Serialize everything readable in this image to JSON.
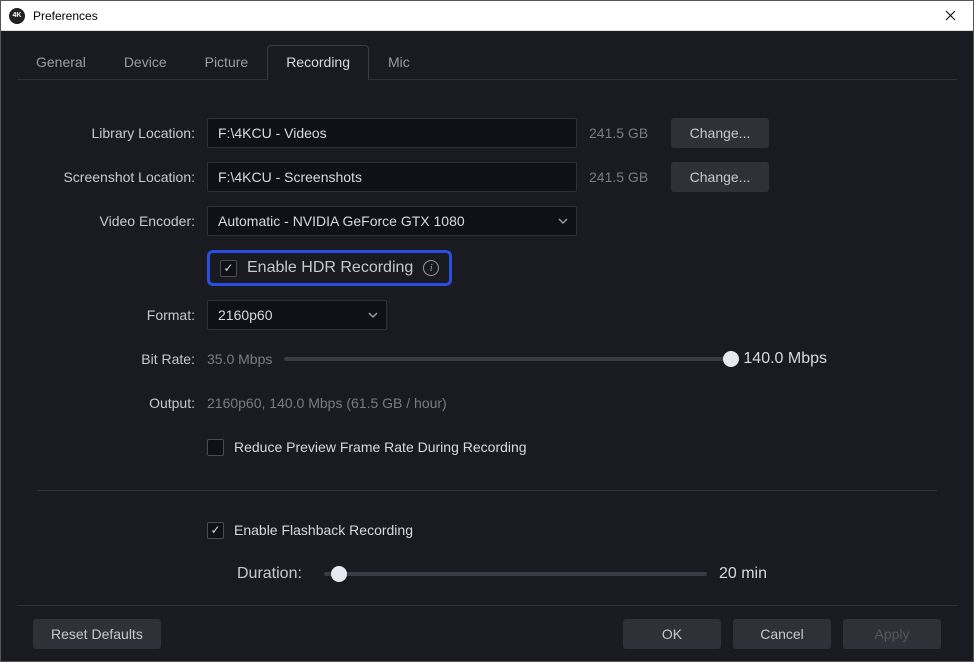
{
  "window": {
    "title": "Preferences"
  },
  "tabs": [
    "General",
    "Device",
    "Picture",
    "Recording",
    "Mic"
  ],
  "active_tab_index": 3,
  "labels": {
    "library_location": "Library Location:",
    "screenshot_location": "Screenshot Location:",
    "video_encoder": "Video Encoder:",
    "format": "Format:",
    "bit_rate": "Bit Rate:",
    "output": "Output:",
    "duration": "Duration:"
  },
  "library": {
    "path": "F:\\4KCU - Videos",
    "free": "241.5 GB",
    "change": "Change..."
  },
  "screenshot": {
    "path": "F:\\4KCU - Screenshots",
    "free": "241.5 GB",
    "change": "Change..."
  },
  "encoder": {
    "value": "Automatic - NVIDIA GeForce GTX 1080"
  },
  "hdr": {
    "label": "Enable HDR Recording",
    "checked": true
  },
  "format": {
    "value": "2160p60"
  },
  "bitrate": {
    "min_label": "35.0 Mbps",
    "max_label": "140.0 Mbps",
    "position_pct": 100
  },
  "output": {
    "summary": "2160p60, 140.0 Mbps (61.5 GB / hour)"
  },
  "reduce_preview": {
    "label": "Reduce Preview Frame Rate During Recording",
    "checked": false
  },
  "flashback": {
    "label": "Enable Flashback Recording",
    "checked": true
  },
  "duration": {
    "value_label": "20 min",
    "position_pct": 4
  },
  "buttons": {
    "reset": "Reset Defaults",
    "ok": "OK",
    "cancel": "Cancel",
    "apply": "Apply"
  }
}
